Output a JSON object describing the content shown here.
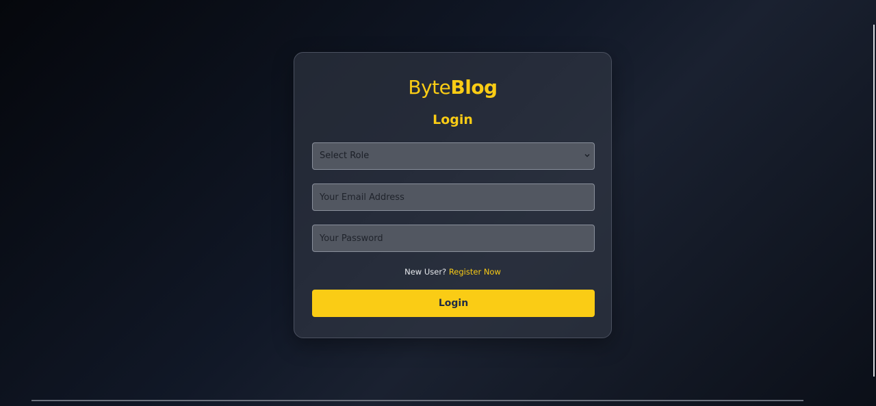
{
  "brand": {
    "logo_light": "Byte",
    "logo_bold": "Blog"
  },
  "login": {
    "title": "Login",
    "role_select": {
      "selected": "Select Role",
      "icon": "chevron-down-icon"
    },
    "email": {
      "value": "",
      "placeholder": "Your Email Address"
    },
    "password": {
      "value": "",
      "placeholder": "Your Password"
    },
    "register_prompt": "New User?",
    "register_link": "Register Now",
    "submit_label": "Login"
  },
  "colors": {
    "accent": "#facc15",
    "button_text": "#1f2a44",
    "card_border": "#4b5160"
  }
}
